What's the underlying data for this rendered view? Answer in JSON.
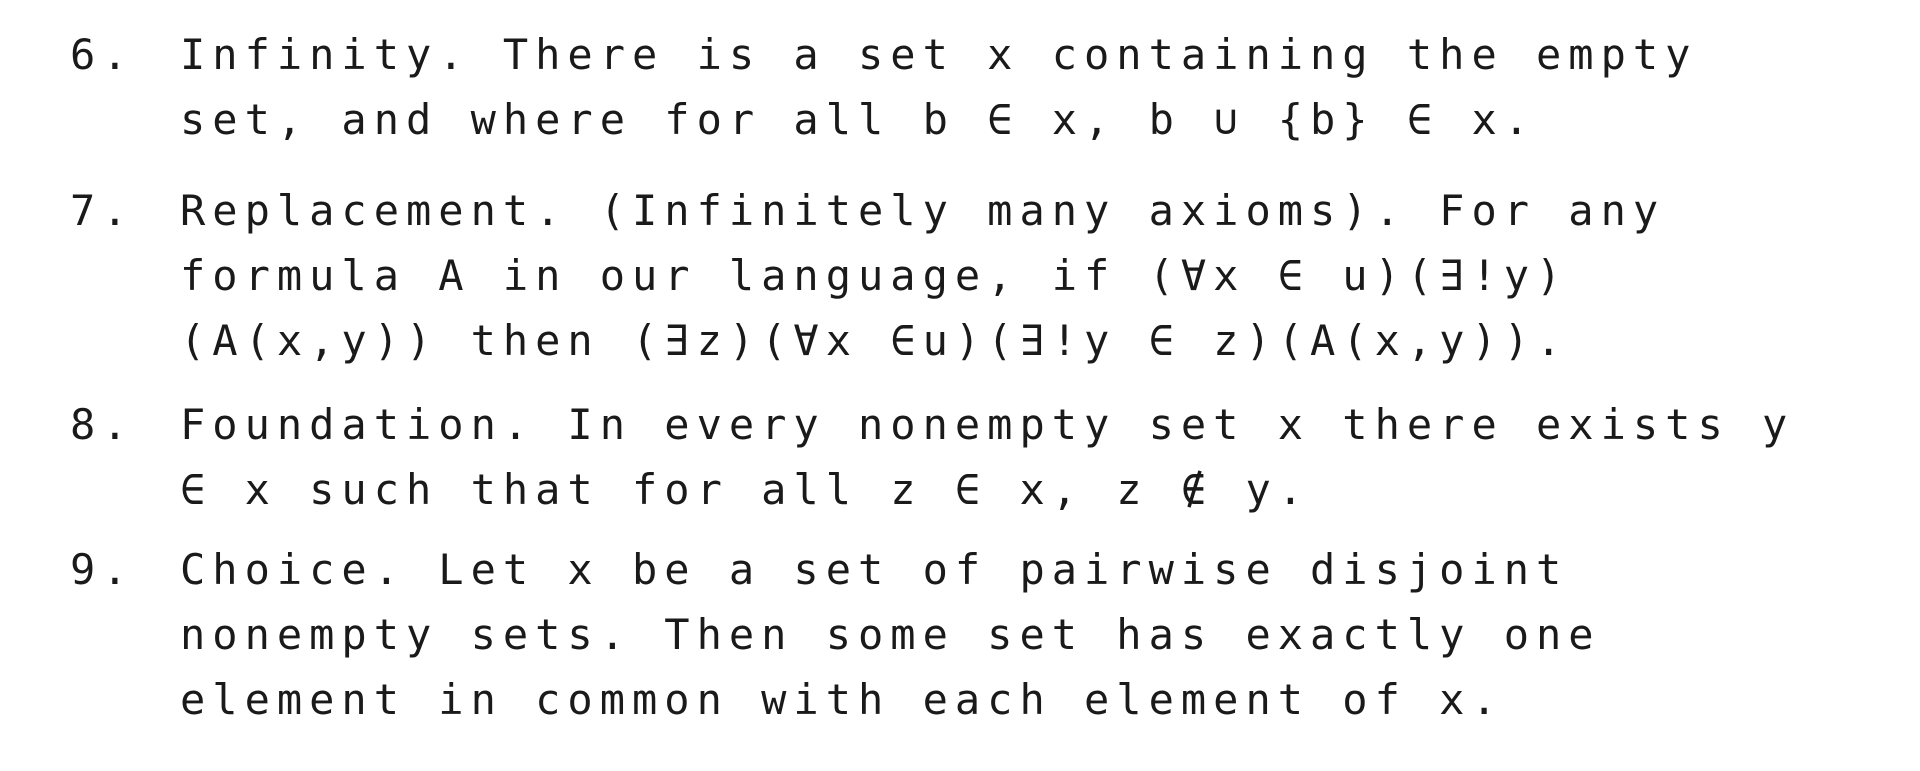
{
  "axioms": [
    {
      "number": "6.",
      "lines": [
        "Infinity. There is a set x containing the empty",
        "set, and where for all b ∈ x, b ∪ {b} ∈ x."
      ]
    },
    {
      "number": "7.",
      "lines": [
        "Replacement. (Infinitely many axioms). For any",
        "formula A in our language, if (∀x ∈ u)(∃!y)",
        "(A(x,y)) then (∃z)(∀x ∈u)(∃!y ∈ z)(A(x,y))."
      ]
    },
    {
      "number": "8.",
      "lines": [
        "Foundation. In every nonempty set x there exists y",
        "∈ x such that for all z ∈ x, z ∉ y."
      ]
    },
    {
      "number": "9.",
      "lines": [
        "Choice. Let x be a set of pairwise disjoint",
        "nonempty sets. Then some set has exactly one",
        "element in common with each element of x."
      ]
    }
  ]
}
